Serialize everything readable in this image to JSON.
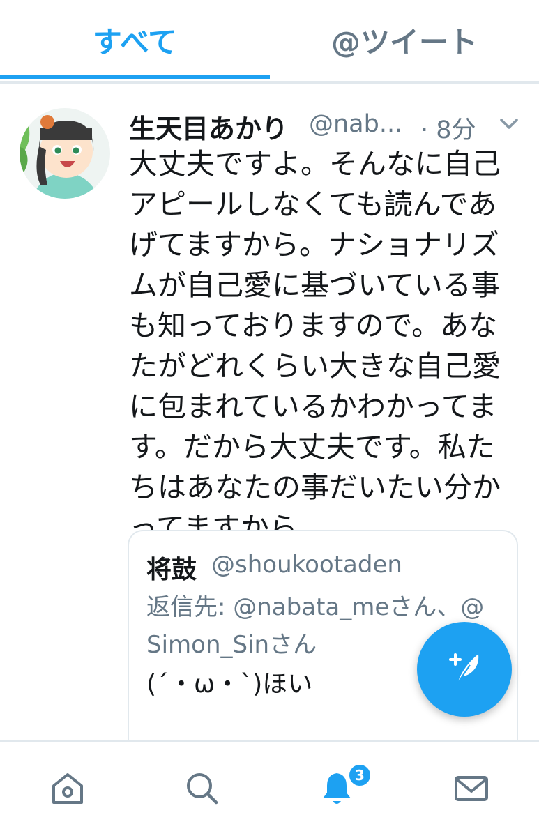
{
  "tabs": [
    {
      "label": "すべて",
      "active": true
    },
    {
      "label": "@ツイート",
      "active": false
    }
  ],
  "tweet": {
    "display_name": "生天目あかり",
    "handle": "@nab...",
    "separator": "·",
    "time": "8分",
    "text": "大丈夫ですよ。そんなに自己アピールしなくても読んであげてますから。ナショナリズムが自己愛に基づいている事も知っておりますので。あなたがどれくらい大きな自己愛に包まれているかわかってます。だから大丈夫です。私たちはあなたの事だいたい分かってますから。"
  },
  "quote": {
    "display_name": "将鼓",
    "handle": "@shoukootaden",
    "reply_to": "返信先: @nabata_meさん、@Simon_Sinさん",
    "text": "(´・ω・`)ほい"
  },
  "nav": {
    "items": [
      "home-icon",
      "search-icon",
      "notifications-icon",
      "messages-icon"
    ],
    "notification_badge": "3"
  },
  "colors": {
    "accent": "#1da1f2",
    "secondary_text": "#657786",
    "divider": "#e1e8ed"
  }
}
